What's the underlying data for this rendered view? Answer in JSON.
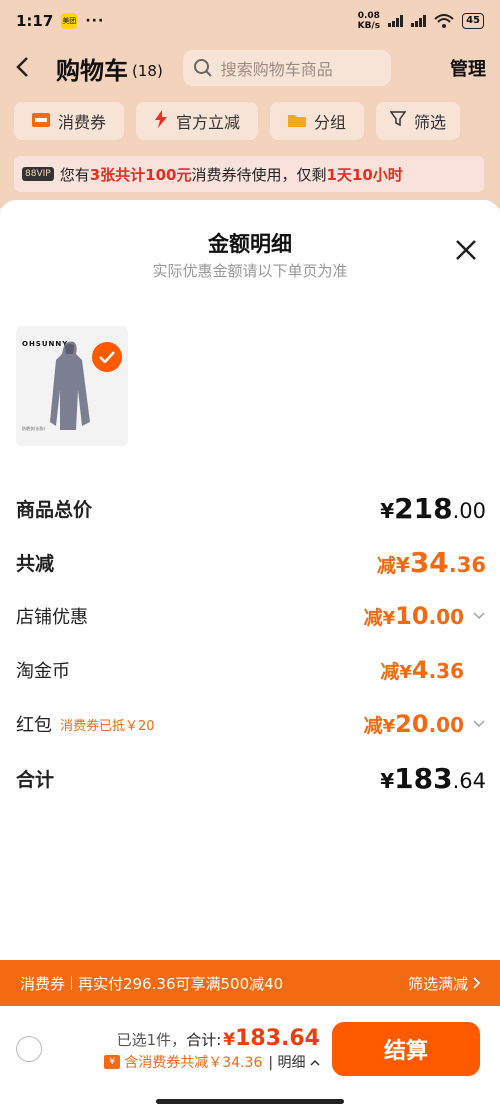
{
  "status": {
    "time": "1:17",
    "app_badge": "美团",
    "dots": "···",
    "speed_top": "0.08",
    "speed_unit": "KB/s",
    "battery": "45"
  },
  "header": {
    "back_icon": "chevron-left-icon",
    "title": "购物车",
    "count": "(18)",
    "search_placeholder": "搜索购物车商品",
    "manage": "管理"
  },
  "filters": [
    {
      "label": "消费券",
      "icon": "ticket-icon"
    },
    {
      "label": "官方立减",
      "icon": "bolt-icon"
    },
    {
      "label": "分组",
      "icon": "folder-icon"
    },
    {
      "label": "筛选",
      "icon": "filter-icon"
    }
  ],
  "notice": {
    "vip": "88VIP",
    "prefix": "您有",
    "highlight1": "3张共计100元",
    "middle": "消费券待使用，仅剩",
    "highlight2": "1天10小时"
  },
  "sheet": {
    "title": "金额明细",
    "subtitle": "实际优惠金额请以下单页为准",
    "product": {
      "brand": "OHSUNNY",
      "caption": "防晒衣(长款)"
    },
    "rows": {
      "total": {
        "label": "商品总价",
        "yen": "¥",
        "int": "218",
        "dec": ".00"
      },
      "discount": {
        "label": "共减",
        "minus": "减",
        "yen": "¥",
        "int": "34",
        "dec": ".36"
      },
      "shop": {
        "label": "店铺优惠",
        "minus": "减",
        "yen": "¥",
        "int": "10",
        "dec": ".00"
      },
      "coin": {
        "label": "淘金币",
        "minus": "减",
        "yen": "¥",
        "int": "4",
        "dec": ".36"
      },
      "redpack": {
        "label": "红包",
        "tag": "消费券已抵￥20",
        "minus": "减",
        "yen": "¥",
        "int": "20",
        "dec": ".00"
      },
      "sum": {
        "label": "合计",
        "yen": "¥",
        "int": "183",
        "dec": ".64"
      }
    }
  },
  "coupon_bar": {
    "label": "消费券",
    "text": "再实付296.36可享满500减40",
    "action": "筛选满减"
  },
  "bottom": {
    "selected": "已选1件，",
    "total_label": "合计:",
    "yen": "¥",
    "amount": "183.64",
    "savings": "含消费券共减￥34.36",
    "detail": "明细",
    "pay": "结算"
  },
  "colors": {
    "accent": "#ff5a00",
    "orange_text": "#f26a14",
    "header_bg": "#f4d3bd"
  }
}
